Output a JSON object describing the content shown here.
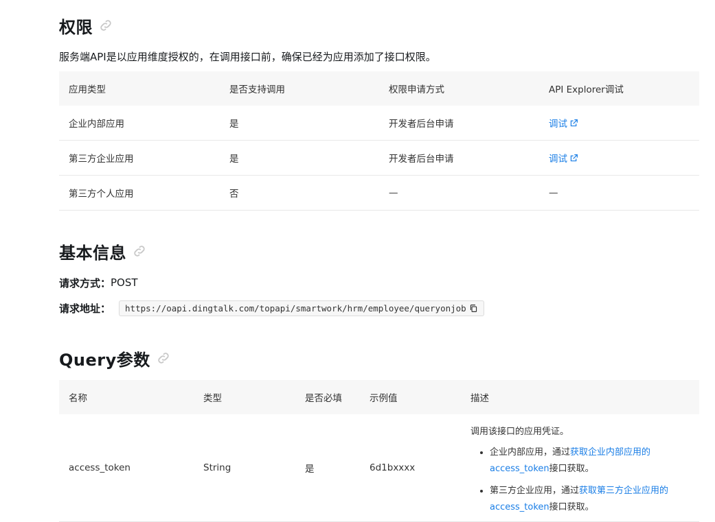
{
  "permissions": {
    "title": "权限",
    "description": "服务端API是以应用维度授权的，在调用接口前，确保已经为应用添加了接口权限。",
    "headers": [
      "应用类型",
      "是否支持调用",
      "权限申请方式",
      "API Explorer调试"
    ],
    "rows": [
      {
        "type": "企业内部应用",
        "supported": "是",
        "apply": "开发者后台申请",
        "debug": "调试",
        "debug_link": true
      },
      {
        "type": "第三方企业应用",
        "supported": "是",
        "apply": "开发者后台申请",
        "debug": "调试",
        "debug_link": true
      },
      {
        "type": "第三方个人应用",
        "supported": "否",
        "apply": "—",
        "debug": "—",
        "debug_link": false
      }
    ]
  },
  "basic_info": {
    "title": "基本信息",
    "method_label": "请求方式：",
    "method_value": "POST",
    "url_label": "请求地址：",
    "url_value": "https://oapi.dingtalk.com/topapi/smartwork/hrm/employee/queryonjob"
  },
  "query_params": {
    "title": "Query参数",
    "headers": [
      "名称",
      "类型",
      "是否必填",
      "示例值",
      "描述"
    ],
    "rows": [
      {
        "name": "access_token",
        "type": "String",
        "required": "是",
        "example": "6d1bxxxx",
        "desc_intro": "调用该接口的应用凭证。",
        "bullets": [
          {
            "prefix": "企业内部应用，通过",
            "link": "获取企业内部应用的access_token",
            "suffix": "接口获取。"
          },
          {
            "prefix": "第三方企业应用，通过",
            "link": "获取第三方企业应用的access_token",
            "suffix": "接口获取。"
          }
        ]
      }
    ]
  },
  "colors": {
    "link": "#1a7ee6",
    "header_bg": "#f7f7f7",
    "border": "#e8e8e8"
  }
}
